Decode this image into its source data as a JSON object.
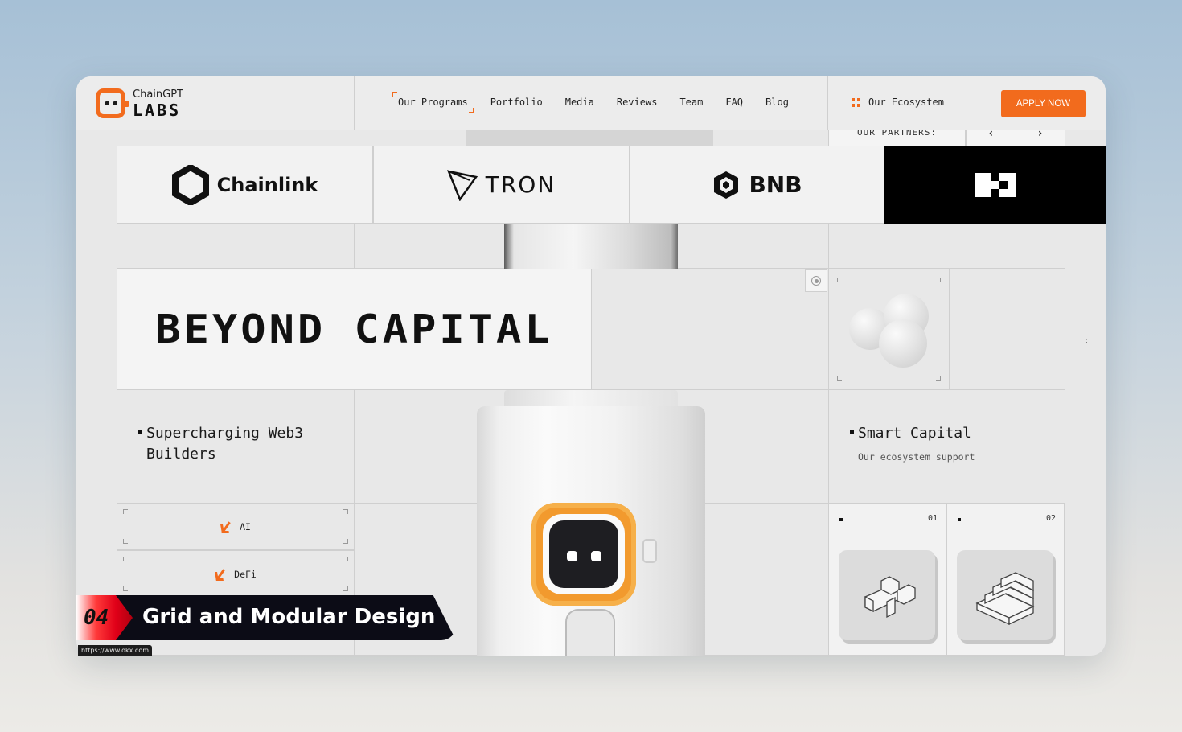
{
  "header": {
    "logo_top": "ChainGPT",
    "logo_bottom": "LABS",
    "nav": [
      "Our Programs",
      "Portfolio",
      "Media",
      "Reviews",
      "Team",
      "FAQ",
      "Blog"
    ],
    "ecosystem": "Our Ecosystem",
    "apply": "APPLY NOW"
  },
  "partners": {
    "label": "OUR PARTNERS:",
    "prev": "‹",
    "next": "›",
    "logos": [
      "Chainlink",
      "TRON",
      "BNB",
      "OKX"
    ]
  },
  "hero": {
    "title": "BEYOND CAPITAL"
  },
  "left": {
    "tagline_1": "Supercharging Web3",
    "tagline_2": "Builders",
    "categories": [
      "AI",
      "DeFi"
    ]
  },
  "right": {
    "tagline": "Smart Capital",
    "subtext": "Our ecosystem support",
    "cards": [
      {
        "num": "01",
        "icon": "cross-block-icon"
      },
      {
        "num": "02",
        "icon": "stairs-block-icon"
      }
    ]
  },
  "overlay": {
    "number": "04",
    "title": "Grid and Modular Design",
    "url": "https://www.okx.com"
  },
  "colors": {
    "accent": "#f26b1d",
    "background": "#e8e8e8",
    "ribbon": "#0c0c16"
  }
}
